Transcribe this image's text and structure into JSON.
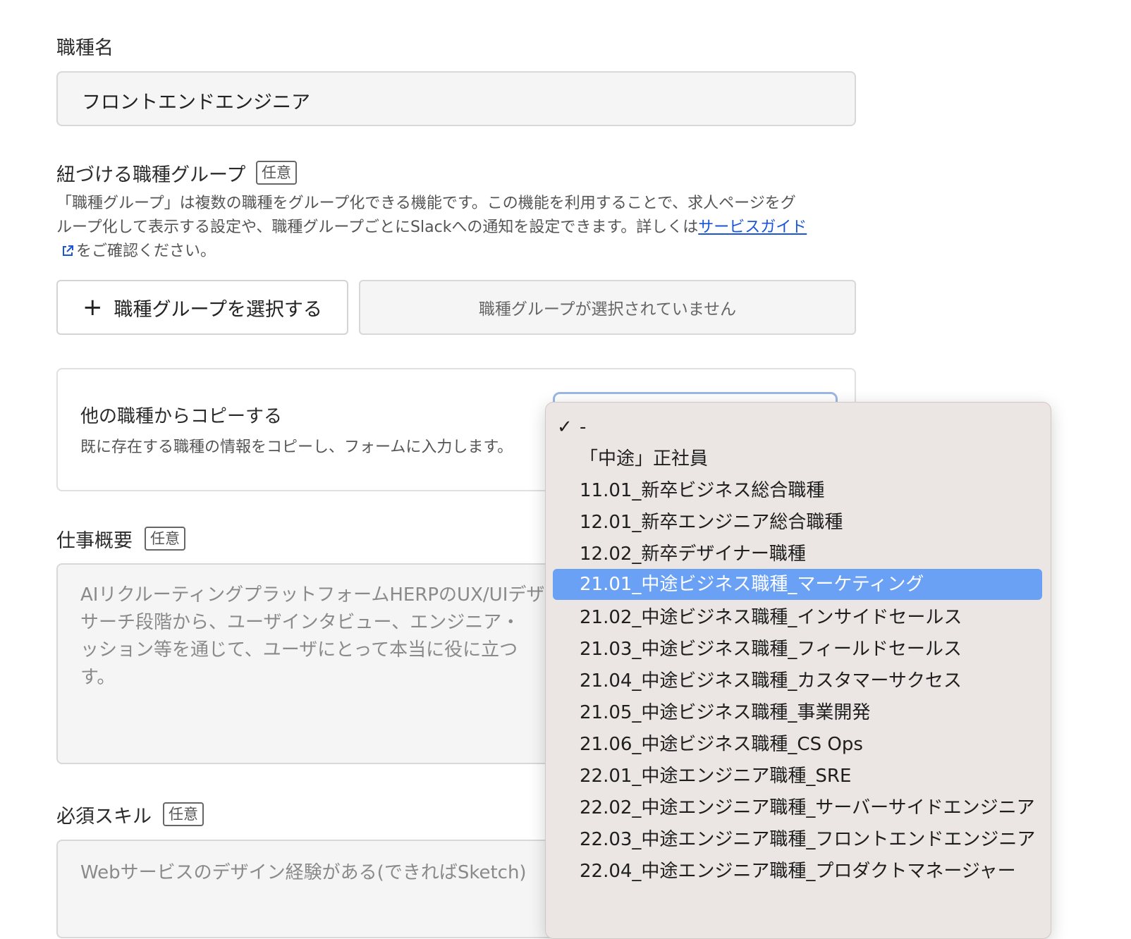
{
  "job_name": {
    "label": "職種名",
    "value": "フロントエンドエンジニア"
  },
  "job_group": {
    "label": "紐づける職種グループ",
    "badge": "任意",
    "help_line1": "「職種グループ」は複数の職種をグループ化できる機能です。この機能を利用することで、求人ページをグ",
    "help_line2": "ループ化して表示する設定や、職種グループごとにSlackへの通知を設定できます。詳しくは",
    "help_link": "サービスガイド",
    "help_line3": "をご確認ください。",
    "select_button": "職種グループを選択する",
    "empty_text": "職種グループが選択されていません"
  },
  "copy_section": {
    "title": "他の職種からコピーする",
    "description": "既に存在する職種の情報をコピーし、フォームに入力します。"
  },
  "job_summary": {
    "label": "仕事概要",
    "badge": "任意",
    "placeholder_lines": [
      "AIリクルーティングプラットフォームHERPのUX/UIデザ",
      "サーチ段階から、ユーザインタビュー、エンジニア・",
      "ッション等を通じて、ユーザにとって本当に役に立つ",
      "す。"
    ]
  },
  "required_skills": {
    "label": "必須スキル",
    "badge": "任意",
    "placeholder": "Webサービスのデザイン経験がある(できればSketch)"
  },
  "dropdown": {
    "selected_index": 5,
    "checked_index": 0,
    "items": [
      "-",
      "「中途」正社員",
      "11.01_新卒ビジネス総合職種",
      "12.01_新卒エンジニア総合職種",
      "12.02_新卒デザイナー職種",
      "21.01_中途ビジネス職種_マーケティング",
      "21.02_中途ビジネス職種_インサイドセールス",
      "21.03_中途ビジネス職種_フィールドセールス",
      "21.04_中途ビジネス職種_カスタマーサクセス",
      "21.05_中途ビジネス職種_事業開発",
      "21.06_中途ビジネス職種_CS Ops",
      "22.01_中途エンジニア職種_SRE",
      "22.02_中途エンジニア職種_サーバーサイドエンジニア",
      "22.03_中途エンジニア職種_フロントエンドエンジニア",
      "22.04_中途エンジニア職種_プロダクトマネージャー"
    ]
  },
  "colors": {
    "link": "#1a55d6",
    "selected_item": "#6aa1f5",
    "dropdown_bg": "#ebe6e3"
  }
}
